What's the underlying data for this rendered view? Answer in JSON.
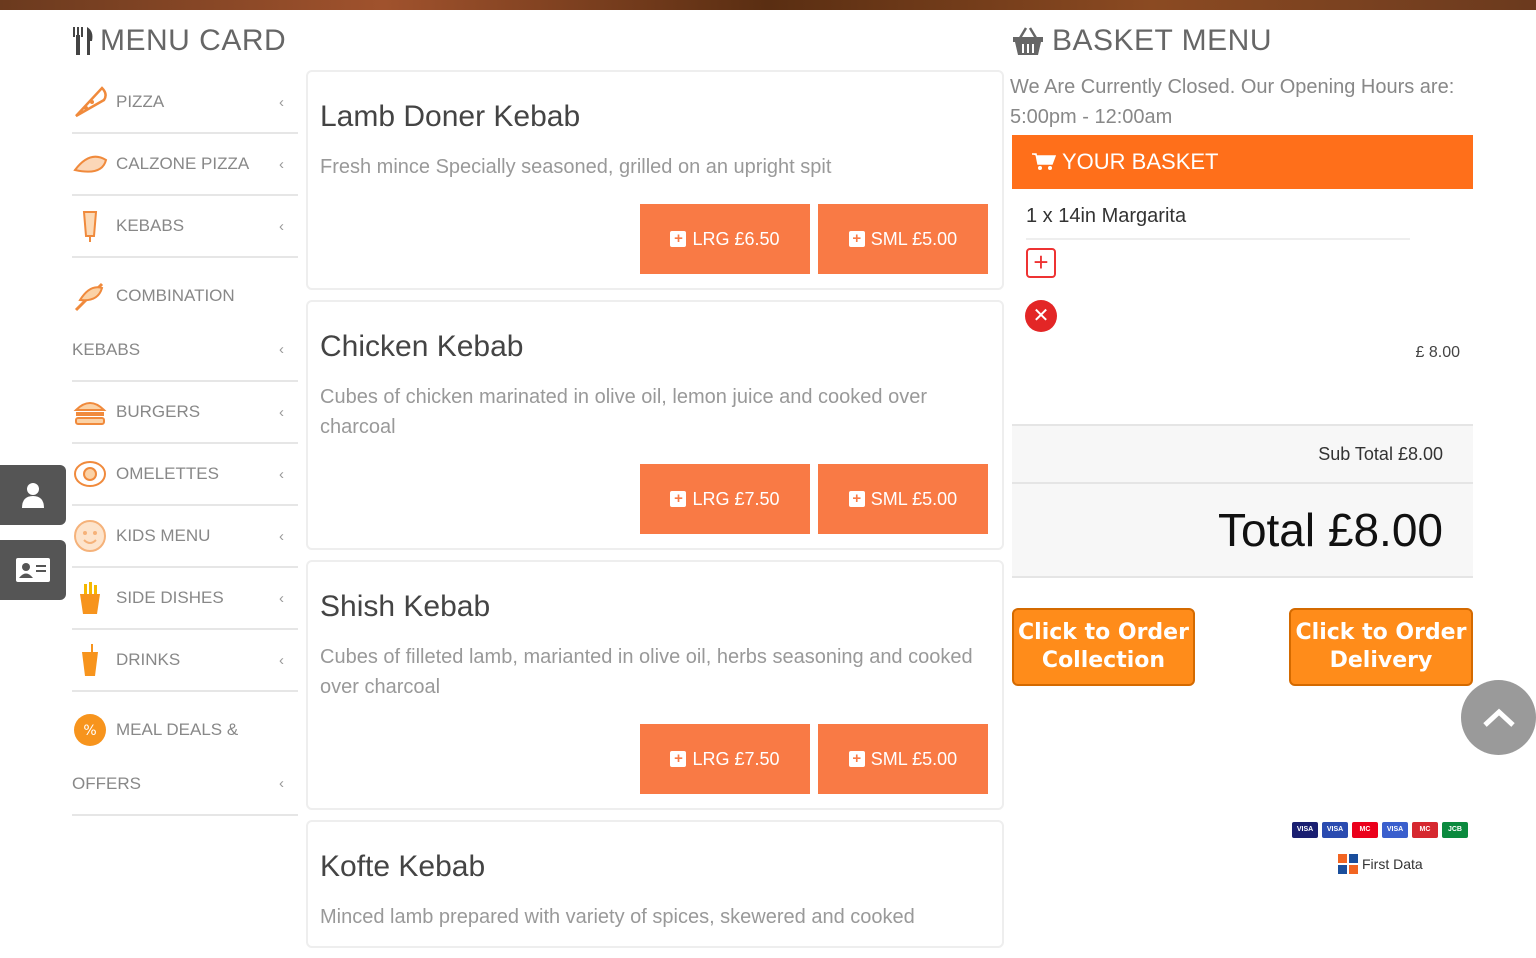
{
  "menu": {
    "title": "MENU CARD",
    "categories": [
      {
        "label": "PIZZA",
        "icon": "pizza-slice-icon"
      },
      {
        "label": "CALZONE PIZZA",
        "icon": "calzone-icon"
      },
      {
        "label": "KEBABS",
        "icon": "kebab-icon"
      },
      {
        "label_line1": "COMBINATION",
        "label_line2": "KEBABS",
        "icon": "combination-icon"
      },
      {
        "label": "BURGERS",
        "icon": "burger-icon"
      },
      {
        "label": "OMELETTES",
        "icon": "omelette-icon"
      },
      {
        "label": "KIDS MENU",
        "icon": "kids-menu-icon"
      },
      {
        "label": "SIDE DISHES",
        "icon": "fries-icon"
      },
      {
        "label": "DRINKS",
        "icon": "drink-icon"
      },
      {
        "label_line1": "MEAL DEALS &",
        "label_line2": "OFFERS",
        "icon": "discount-icon"
      }
    ]
  },
  "items": [
    {
      "name": "Lamb Doner Kebab",
      "description": "Fresh mince Specially seasoned, grilled on an upright spit",
      "lrg": "LRG £6.50",
      "sml": "SML £5.00"
    },
    {
      "name": "Chicken Kebab",
      "description": "Cubes of chicken marinated in olive oil, lemon juice and cooked over charcoal",
      "lrg": "LRG £7.50",
      "sml": "SML £5.00"
    },
    {
      "name": "Shish Kebab",
      "description": "Cubes of filleted lamb, marianted in olive oil, herbs seasoning and cooked over charcoal",
      "lrg": "LRG £7.50",
      "sml": "SML £5.00"
    },
    {
      "name": "Kofte Kebab",
      "description": "Minced lamb prepared with variety of spices, skewered and cooked"
    }
  ],
  "basket": {
    "title": "BASKET MENU",
    "closed_message": "We Are Currently Closed. Our Opening Hours are: 5:00pm - 12:00am",
    "your_basket": "YOUR BASKET",
    "line_item": "1 x 14in Margarita",
    "line_price": "£ 8.00",
    "subtotal": "Sub Total £8.00",
    "total": "Total £8.00",
    "collection_line1": "Click to Order",
    "collection_line2": "Collection",
    "delivery_line1": "Click to Order",
    "delivery_line2": "Delivery"
  },
  "payments": {
    "cards": [
      {
        "label": "VISA",
        "color": "#1a1f71"
      },
      {
        "label": "VISA",
        "color": "#2a4bb0"
      },
      {
        "label": "MC",
        "color": "#eb001b"
      },
      {
        "label": "VISA",
        "color": "#3a5fcd"
      },
      {
        "label": "MC",
        "color": "#d6282f"
      },
      {
        "label": "JCB",
        "color": "#0b8a3e"
      }
    ],
    "provider": "First Data"
  },
  "colors": {
    "accent": "#ff6f1a",
    "button": "#f97a45",
    "order_button": "#ff8c1a"
  }
}
